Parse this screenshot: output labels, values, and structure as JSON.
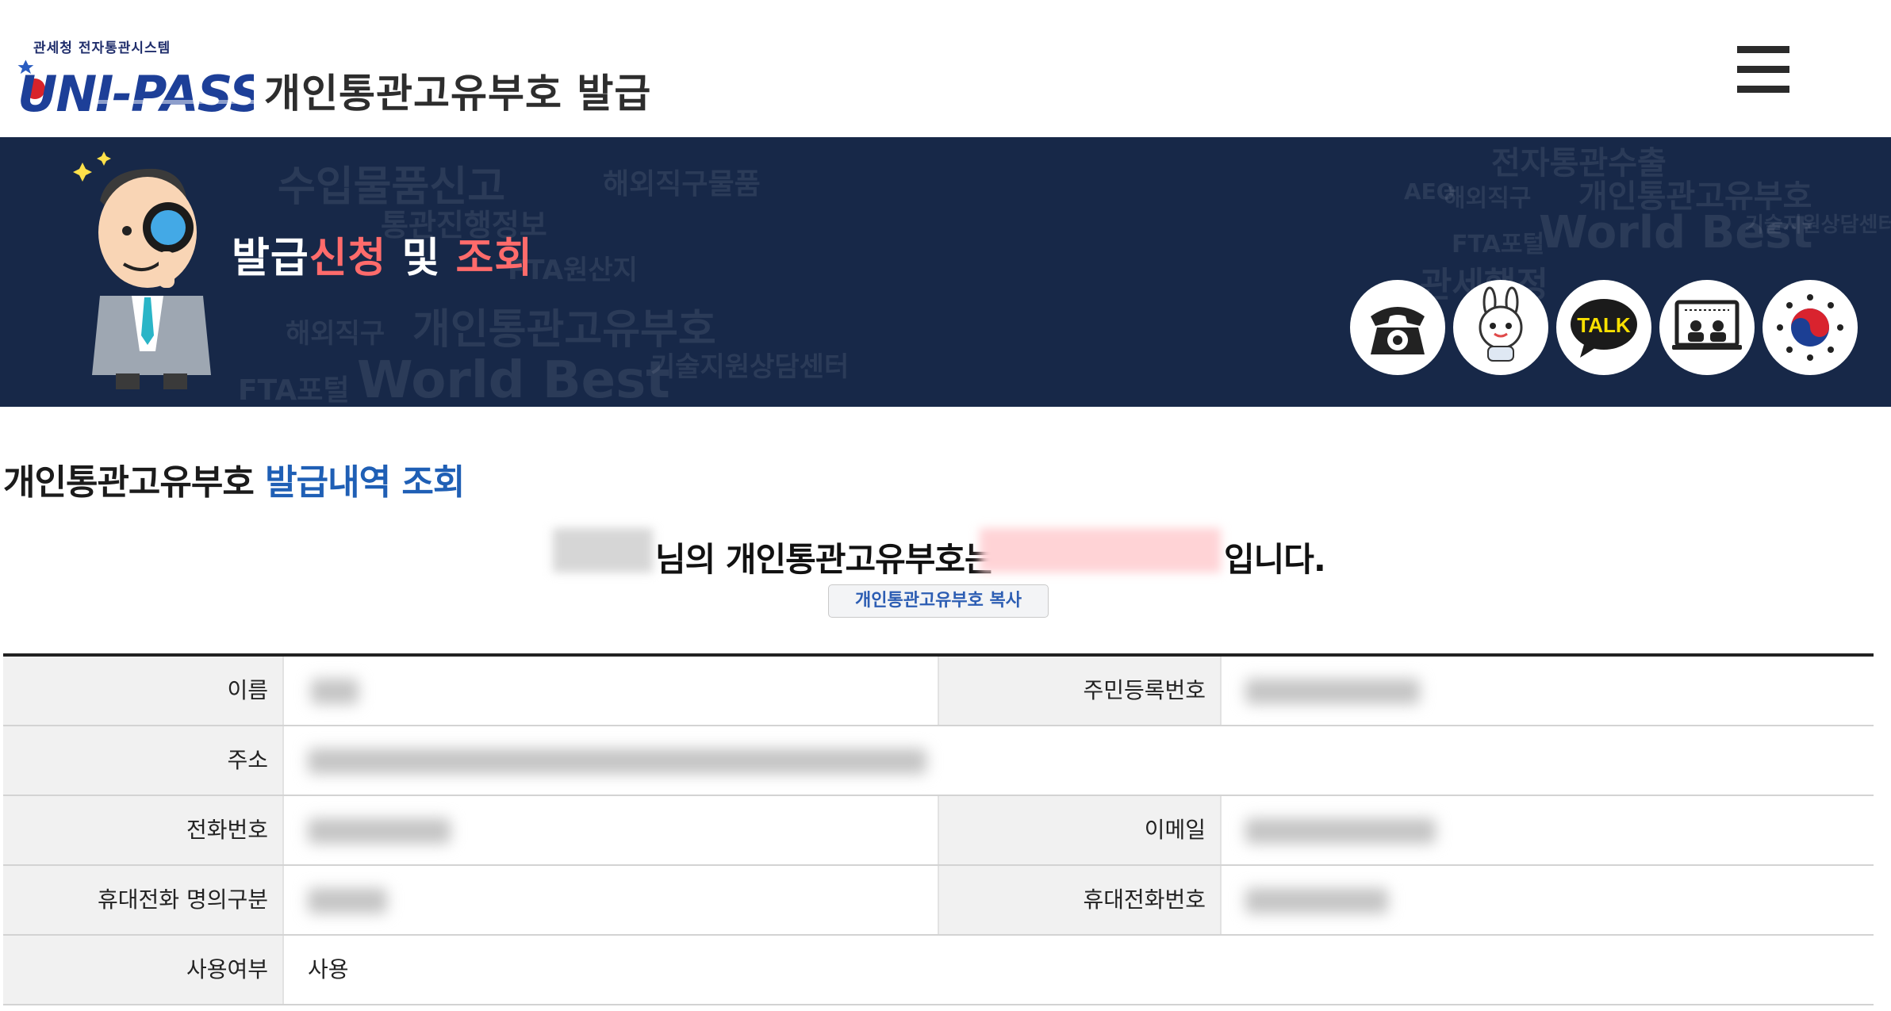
{
  "header": {
    "logo_top": "관세청 전자통관시스템",
    "logo_word": "UNI-PASS",
    "title": "개인통관고유부호 발급"
  },
  "banner": {
    "title_part1": "발급",
    "title_part2": "신청",
    "title_part3": " 및 ",
    "title_part4": "조회",
    "accent_color": "#ff6b6b",
    "background_color": "#172848",
    "quick_links": [
      "phone-icon",
      "chatbot-icon",
      "kakao-talk-icon",
      "remote-support-icon",
      "government-emblem-icon"
    ],
    "talk_label": "TALK"
  },
  "section": {
    "title_part1": "개인통관고유부호 ",
    "title_part2": "발급내역 조회"
  },
  "result": {
    "text1": "님의 개인통관고유부호는",
    "text2": "입니다.",
    "copy_button": "개인통관고유부호 복사"
  },
  "table": {
    "name_label": "이름",
    "rrn_label": "주민등록번호",
    "address_label": "주소",
    "phone_label": "전화번호",
    "email_label": "이메일",
    "mobile_owner_label": "휴대전화 명의구분",
    "mobile_label": "휴대전화번호",
    "usage_label": "사용여부",
    "usage_value": "사용"
  }
}
